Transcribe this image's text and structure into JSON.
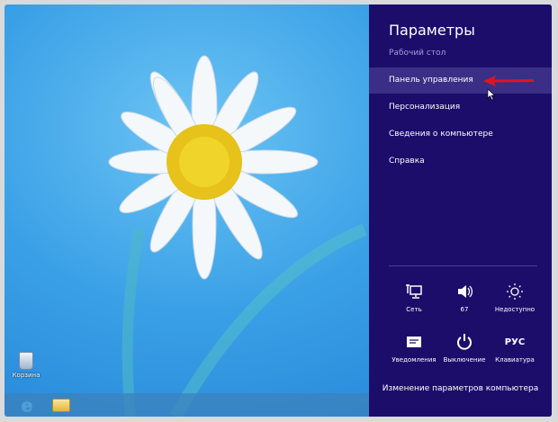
{
  "desktop": {
    "recycle_bin_label": "Корзина"
  },
  "charm": {
    "title": "Параметры",
    "subtitle": "Рабочий стол",
    "items": [
      {
        "label": "Панель управления",
        "selected": true
      },
      {
        "label": "Персонализация"
      },
      {
        "label": "Сведения о компьютере"
      },
      {
        "label": "Справка"
      }
    ],
    "tiles": [
      {
        "label": "Сеть",
        "icon": "network-icon"
      },
      {
        "label": "67",
        "icon": "volume-icon"
      },
      {
        "label": "Недоступно",
        "icon": "brightness-icon"
      },
      {
        "label": "Уведомления",
        "icon": "notifications-icon"
      },
      {
        "label": "Выключение",
        "icon": "power-icon"
      },
      {
        "label": "Клавиатура",
        "icon": "keyboard-icon",
        "glyph": "РУС"
      }
    ],
    "footer_link": "Изменение параметров компьютера"
  },
  "colors": {
    "panel": "#1c0d6b",
    "highlight": "#3b2e86",
    "arrow": "#e0141e"
  }
}
